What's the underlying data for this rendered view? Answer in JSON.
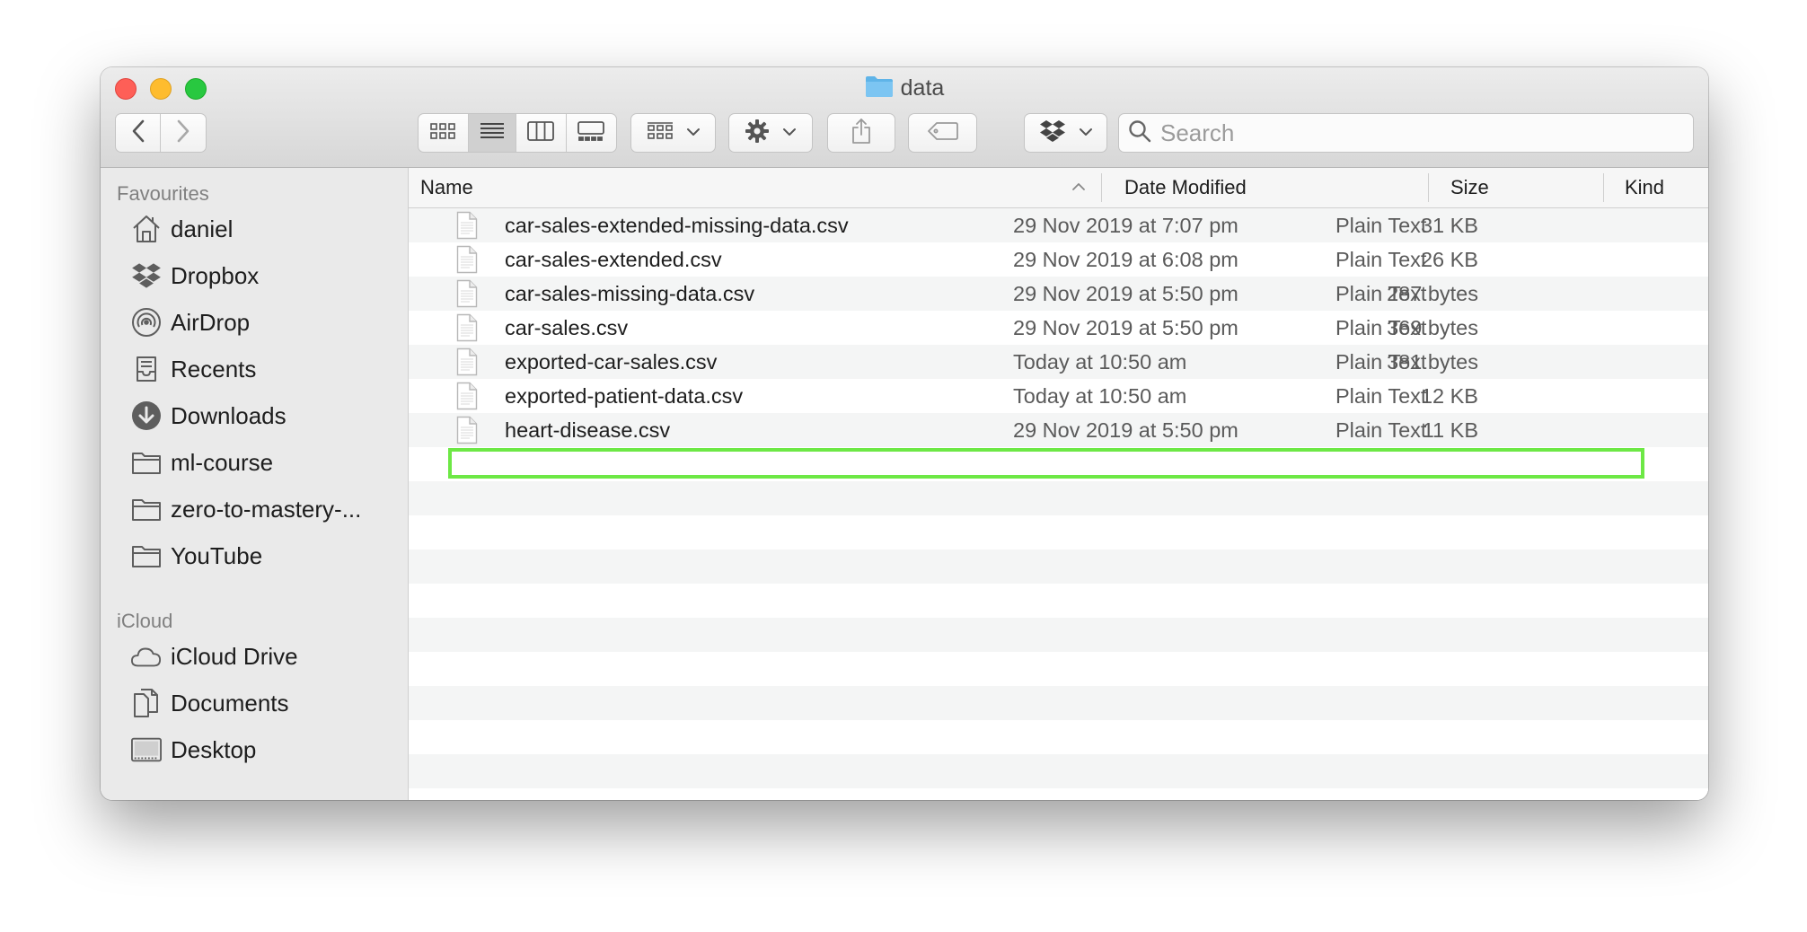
{
  "window": {
    "title": "data"
  },
  "toolbar": {
    "back_icon": "chevron-left-icon",
    "forward_icon": "chevron-right-icon",
    "view_modes": [
      "icon-view",
      "list-view",
      "column-view",
      "gallery-view"
    ],
    "active_view": "list-view",
    "group_icon": "group-by-icon",
    "action_icon": "gear-icon",
    "share_icon": "share-icon",
    "tag_icon": "tag-icon",
    "dropbox_icon": "dropbox-icon"
  },
  "search": {
    "placeholder": "Search"
  },
  "sidebar": {
    "favourites_heading": "Favourites",
    "favourites": [
      {
        "label": "daniel",
        "icon": "home-icon"
      },
      {
        "label": "Dropbox",
        "icon": "dropbox-icon"
      },
      {
        "label": "AirDrop",
        "icon": "airdrop-icon"
      },
      {
        "label": "Recents",
        "icon": "recents-icon"
      },
      {
        "label": "Downloads",
        "icon": "downloads-icon"
      },
      {
        "label": "ml-course",
        "icon": "folder-icon"
      },
      {
        "label": "zero-to-mastery-...",
        "icon": "folder-icon"
      },
      {
        "label": "YouTube",
        "icon": "folder-icon"
      }
    ],
    "icloud_heading": "iCloud",
    "icloud": [
      {
        "label": "iCloud Drive",
        "icon": "cloud-icon"
      },
      {
        "label": "Documents",
        "icon": "documents-icon"
      },
      {
        "label": "Desktop",
        "icon": "desktop-icon"
      }
    ]
  },
  "columns": {
    "name": "Name",
    "date_modified": "Date Modified",
    "size": "Size",
    "kind": "Kind"
  },
  "files": [
    {
      "name": "car-sales-extended-missing-data.csv",
      "date": "29 Nov 2019 at 7:07 pm",
      "size": "31 KB",
      "kind": "Plain Text"
    },
    {
      "name": "car-sales-extended.csv",
      "date": "29 Nov 2019 at 6:08 pm",
      "size": "26 KB",
      "kind": "Plain Text"
    },
    {
      "name": "car-sales-missing-data.csv",
      "date": "29 Nov 2019 at 5:50 pm",
      "size": "287 bytes",
      "kind": "Plain Text"
    },
    {
      "name": "car-sales.csv",
      "date": "29 Nov 2019 at 5:50 pm",
      "size": "369 bytes",
      "kind": "Plain Text"
    },
    {
      "name": "exported-car-sales.csv",
      "date": "Today at 10:50 am",
      "size": "381 bytes",
      "kind": "Plain Text"
    },
    {
      "name": "exported-patient-data.csv",
      "date": "Today at 10:50 am",
      "size": "12 KB",
      "kind": "Plain Text"
    },
    {
      "name": "heart-disease.csv",
      "date": "29 Nov 2019 at 5:50 pm",
      "size": "11 KB",
      "kind": "Plain Text"
    }
  ],
  "highlighted_file": "exported-patient-data.csv",
  "colors": {
    "close": "#fe5f57",
    "minimize": "#febc2e",
    "maximize": "#28c840",
    "highlight": "#6de845",
    "folder_blue": "#5fb4e8"
  }
}
